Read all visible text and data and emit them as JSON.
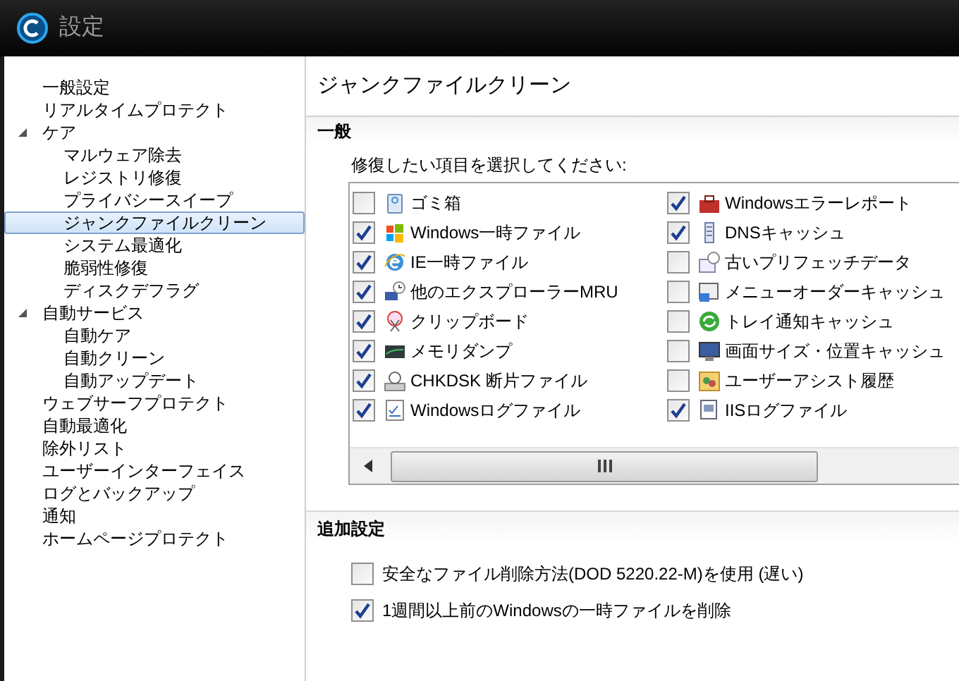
{
  "window": {
    "title": "設定"
  },
  "sidebar": {
    "items": [
      {
        "label": "一般設定",
        "selected": false
      },
      {
        "label": "リアルタイムプロテクト",
        "selected": false
      },
      {
        "label": "ケア",
        "selected": false,
        "expanded": true,
        "children": [
          {
            "label": "マルウェア除去",
            "selected": false
          },
          {
            "label": "レジストリ修復",
            "selected": false
          },
          {
            "label": "プライバシースイープ",
            "selected": false
          },
          {
            "label": "ジャンクファイルクリーン",
            "selected": true
          },
          {
            "label": "システム最適化",
            "selected": false
          },
          {
            "label": "脆弱性修復",
            "selected": false
          },
          {
            "label": "ディスクデフラグ",
            "selected": false
          }
        ]
      },
      {
        "label": "自動サービス",
        "selected": false,
        "expanded": true,
        "children": [
          {
            "label": "自動ケア",
            "selected": false
          },
          {
            "label": "自動クリーン",
            "selected": false
          },
          {
            "label": "自動アップデート",
            "selected": false
          }
        ]
      },
      {
        "label": "ウェブサーフプロテクト",
        "selected": false
      },
      {
        "label": "自動最適化",
        "selected": false
      },
      {
        "label": "除外リスト",
        "selected": false
      },
      {
        "label": "ユーザーインターフェイス",
        "selected": false
      },
      {
        "label": "ログとバックアップ",
        "selected": false
      },
      {
        "label": "通知",
        "selected": false
      },
      {
        "label": "ホームページプロテクト",
        "selected": false
      }
    ]
  },
  "page": {
    "title": "ジャンクファイルクリーン",
    "general": {
      "header": "一般",
      "prompt": "修復したい項目を選択してください:",
      "columns": [
        [
          {
            "label": "ゴミ箱",
            "checked": false
          },
          {
            "label": "Windows一時ファイル",
            "checked": true
          },
          {
            "label": "IE一時ファイル",
            "checked": true
          },
          {
            "label": "他のエクスプローラーMRU",
            "checked": true
          },
          {
            "label": "クリップボード",
            "checked": true
          },
          {
            "label": "メモリダンプ",
            "checked": true
          },
          {
            "label": "CHKDSK 断片ファイル",
            "checked": true
          },
          {
            "label": "Windowsログファイル",
            "checked": true
          }
        ],
        [
          {
            "label": "Windowsエラーレポート",
            "checked": true
          },
          {
            "label": "DNSキャッシュ",
            "checked": true
          },
          {
            "label": "古いプリフェッチデータ",
            "checked": false
          },
          {
            "label": "メニューオーダーキャッシュ",
            "checked": false
          },
          {
            "label": "トレイ通知キャッシュ",
            "checked": false
          },
          {
            "label": "画面サイズ・位置キャッシュ",
            "checked": false
          },
          {
            "label": "ユーザーアシスト履歴",
            "checked": false
          },
          {
            "label": "IISログファイル",
            "checked": true
          }
        ]
      ]
    },
    "additional": {
      "header": "追加設定",
      "options": [
        {
          "label": "安全なファイル削除方法(DOD 5220.22-M)を使用 (遅い)",
          "checked": false
        },
        {
          "label": "1週間以上前のWindowsの一時ファイルを削除",
          "checked": true
        }
      ]
    }
  }
}
